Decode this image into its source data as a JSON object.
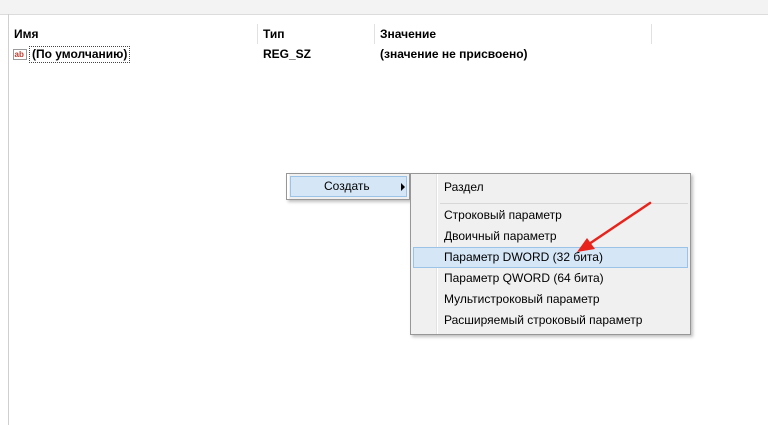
{
  "columns": {
    "name": "Имя",
    "type": "Тип",
    "value": "Значение"
  },
  "rows": [
    {
      "icon": "string-value-icon",
      "name": "(По умолчанию)",
      "type": "REG_SZ",
      "value": "(значение не присвоено)"
    }
  ],
  "context_menu": {
    "create_label": "Создать"
  },
  "submenu": {
    "items": [
      {
        "label": "Раздел"
      },
      {
        "label": "Строковый параметр"
      },
      {
        "label": "Двоичный параметр"
      },
      {
        "label": "Параметр DWORD (32 бита)",
        "highlighted": true
      },
      {
        "label": "Параметр QWORD (64 бита)"
      },
      {
        "label": "Мультистроковый параметр"
      },
      {
        "label": "Расширяемый строковый параметр"
      }
    ]
  },
  "colors": {
    "highlight": "#d5e6f7",
    "annotation_arrow": "#e8231c"
  }
}
